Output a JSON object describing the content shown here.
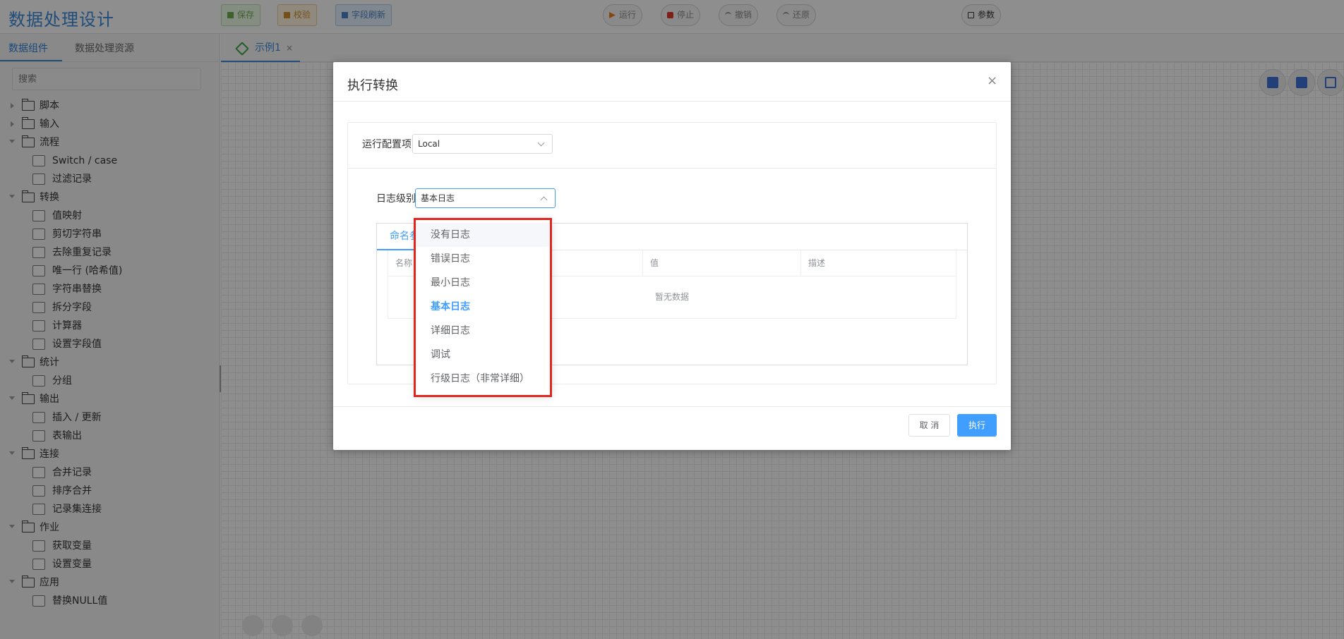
{
  "app": {
    "title": "数据处理设计"
  },
  "toolbar": {
    "save": "保存",
    "check": "校验",
    "refresh_fields": "字段刷新",
    "run": "运行",
    "stop": "停止",
    "undo": "撤销",
    "redo": "还原",
    "params": "参数"
  },
  "sidebar": {
    "tabs": [
      "数据组件",
      "数据处理资源"
    ],
    "search_placeholder": "搜索",
    "tree": [
      {
        "label": "脚本",
        "type": "folder",
        "expanded": false
      },
      {
        "label": "输入",
        "type": "folder",
        "expanded": false
      },
      {
        "label": "流程",
        "type": "folder",
        "expanded": true
      },
      {
        "label": "Switch / case",
        "type": "leaf"
      },
      {
        "label": "过滤记录",
        "type": "leaf"
      },
      {
        "label": "转换",
        "type": "folder",
        "expanded": true
      },
      {
        "label": "值映射",
        "type": "leaf"
      },
      {
        "label": "剪切字符串",
        "type": "leaf"
      },
      {
        "label": "去除重复记录",
        "type": "leaf"
      },
      {
        "label": "唯一行 (哈希值)",
        "type": "leaf"
      },
      {
        "label": "字符串替换",
        "type": "leaf"
      },
      {
        "label": "拆分字段",
        "type": "leaf"
      },
      {
        "label": "计算器",
        "type": "leaf"
      },
      {
        "label": "设置字段值",
        "type": "leaf"
      },
      {
        "label": "统计",
        "type": "folder",
        "expanded": true
      },
      {
        "label": "分组",
        "type": "leaf"
      },
      {
        "label": "输出",
        "type": "folder",
        "expanded": true
      },
      {
        "label": "插入 / 更新",
        "type": "leaf"
      },
      {
        "label": "表输出",
        "type": "leaf"
      },
      {
        "label": "连接",
        "type": "folder",
        "expanded": true
      },
      {
        "label": "合并记录",
        "type": "leaf"
      },
      {
        "label": "排序合并",
        "type": "leaf"
      },
      {
        "label": "记录集连接",
        "type": "leaf"
      },
      {
        "label": "作业",
        "type": "folder",
        "expanded": true
      },
      {
        "label": "获取变量",
        "type": "leaf"
      },
      {
        "label": "设置变量",
        "type": "leaf"
      },
      {
        "label": "应用",
        "type": "folder",
        "expanded": true
      },
      {
        "label": "替换NULL值",
        "type": "leaf"
      }
    ]
  },
  "canvas": {
    "tab_label": "示例1",
    "tab_close": "×"
  },
  "dialog": {
    "title": "执行转换",
    "close": "×",
    "run_config_label": "运行配置项",
    "run_config_value": "Local",
    "log_level_label": "日志级别",
    "log_level_value": "基本日志",
    "tab_label": "命名参数",
    "table_headers": [
      "名称",
      "值",
      "描述"
    ],
    "empty_text": "暂无数据",
    "cancel": "取 消",
    "execute": "执行"
  },
  "dropdown": {
    "options": [
      "没有日志",
      "错误日志",
      "最小日志",
      "基本日志",
      "详细日志",
      "调试",
      "行级日志（非常详细）"
    ],
    "selected": "基本日志",
    "hovered": "没有日志"
  },
  "colors": {
    "accent": "#409eff",
    "brand": "#3a86d4",
    "highlight": "#e0261d"
  }
}
